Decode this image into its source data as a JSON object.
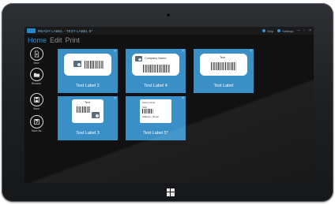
{
  "window": {
    "title": "READY LABEL - TEST LABEL 5*",
    "right_items": [
      {
        "label": "Help",
        "icon": "help-icon"
      },
      {
        "label": "Settings",
        "icon": "settings-icon"
      }
    ],
    "controls": [
      "minimize",
      "maximize",
      "close"
    ]
  },
  "tabs": [
    {
      "label": "Home",
      "active": true
    },
    {
      "label": "Edit",
      "active": false
    },
    {
      "label": "Print",
      "active": false
    }
  ],
  "sidebar": {
    "items": [
      {
        "label": "New",
        "icon": "new-document-icon"
      },
      {
        "label": "Browse",
        "icon": "folder-icon"
      },
      {
        "label": "Save",
        "icon": "save-icon"
      },
      {
        "label": "Save As",
        "icon": "save-as-icon"
      }
    ]
  },
  "labels": [
    {
      "name": "Test Label 2",
      "design": "logo-barcode"
    },
    {
      "name": "Test Label 4",
      "design": "company",
      "card_text": "Company Name"
    },
    {
      "name": "Test Label",
      "design": "text-barcode",
      "card_text": "Text"
    },
    {
      "name": "Test Label 3",
      "design": "text-logo-barcode",
      "card_text": "Text"
    },
    {
      "name": "Test Label 5*",
      "design": "address",
      "card_lines": [
        "Some name",
        "Vest",
        "Address",
        "Name"
      ]
    }
  ],
  "colors": {
    "accent": "#2e8ed6",
    "tile": "#3a8fc7",
    "screen_bg": "#111111"
  }
}
